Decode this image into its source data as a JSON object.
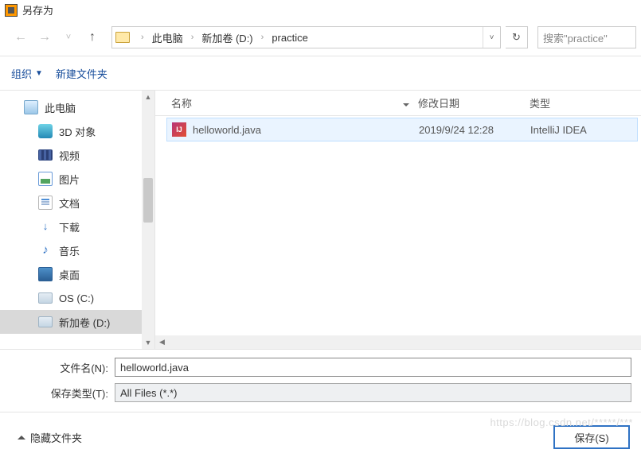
{
  "title": "另存为",
  "breadcrumb": {
    "items": [
      "此电脑",
      "新加卷 (D:)",
      "practice"
    ]
  },
  "search": {
    "placeholder": "搜索\"practice\""
  },
  "toolbar": {
    "organize": "组织",
    "new_folder": "新建文件夹"
  },
  "navpane": {
    "items": [
      {
        "label": "此电脑",
        "icon": "pc"
      },
      {
        "label": "3D 对象",
        "icon": "3d"
      },
      {
        "label": "视频",
        "icon": "video"
      },
      {
        "label": "图片",
        "icon": "pic"
      },
      {
        "label": "文档",
        "icon": "doc"
      },
      {
        "label": "下载",
        "icon": "dl"
      },
      {
        "label": "音乐",
        "icon": "music"
      },
      {
        "label": "桌面",
        "icon": "desktop"
      },
      {
        "label": "OS (C:)",
        "icon": "drive"
      },
      {
        "label": "新加卷 (D:)",
        "icon": "drive",
        "selected": true
      }
    ]
  },
  "columns": {
    "name": "名称",
    "date": "修改日期",
    "type": "类型"
  },
  "rows": [
    {
      "name": "helloworld.java",
      "date": "2019/9/24 12:28",
      "type": "IntelliJ IDEA"
    }
  ],
  "form": {
    "filename_label": "文件名(N):",
    "filename_value": "helloworld.java",
    "type_label": "保存类型(T):",
    "type_value": "All Files (*.*)"
  },
  "footer": {
    "hide_folders": "隐藏文件夹",
    "save": "保存(S)"
  },
  "watermark": "https://blog.csdn.net/*****/***"
}
